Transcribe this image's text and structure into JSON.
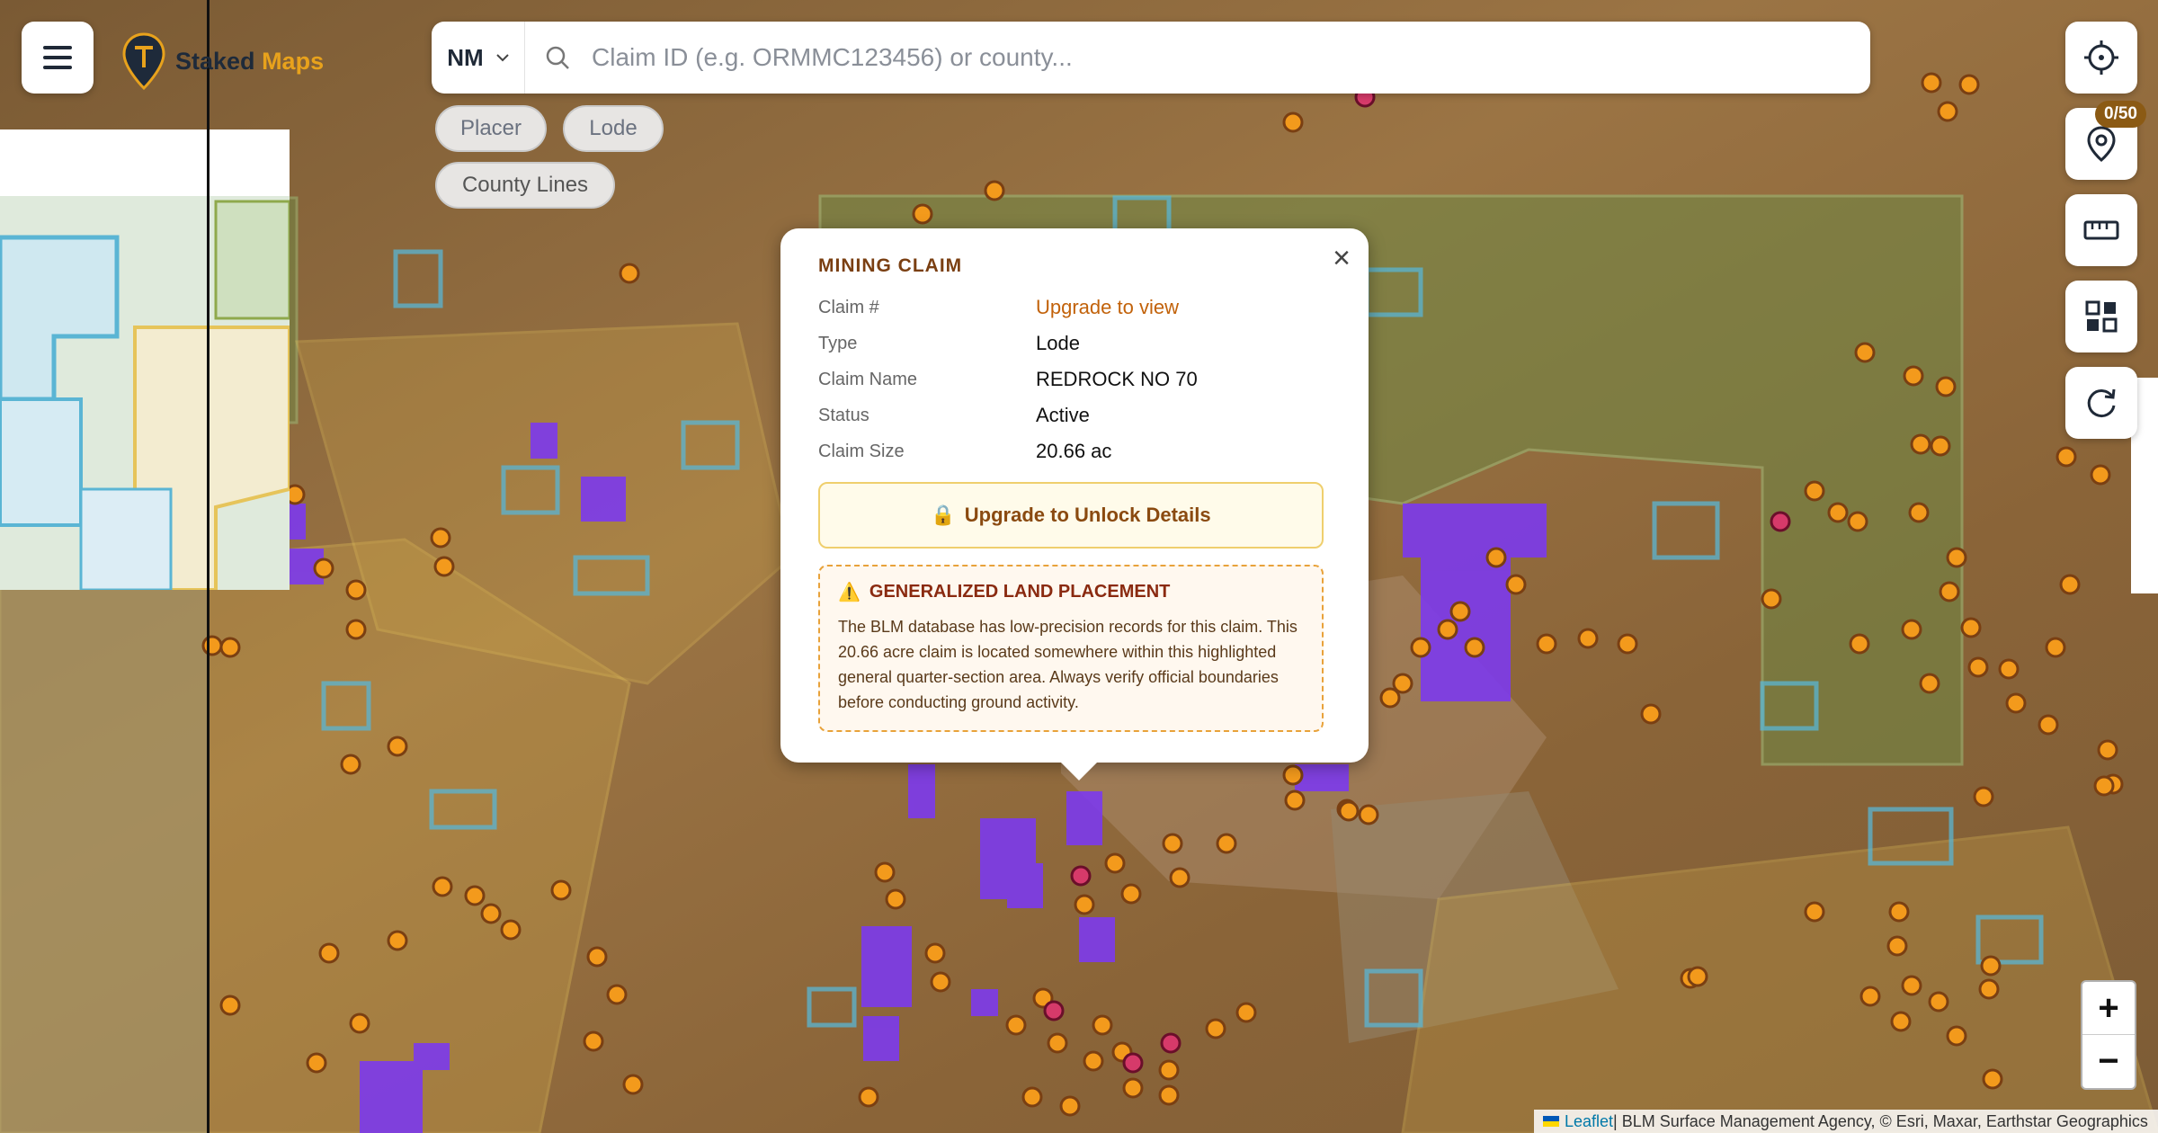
{
  "app": {
    "brand_primary": "Staked",
    "brand_secondary": "Maps",
    "brand_colors": {
      "primary": "#1e2a3a",
      "accent": "#e8a21c"
    }
  },
  "header": {
    "state_selected": "NM",
    "search_placeholder": "Claim ID (e.g. ORMMC123456) or county..."
  },
  "filters": {
    "placer": "Placer",
    "lode": "Lode",
    "county_lines": "County Lines"
  },
  "tools": {
    "claims_count_badge": "0/50",
    "icons": [
      "crosshair-icon",
      "location-pin-icon",
      "ruler-icon",
      "layers-grid-icon",
      "refresh-icon"
    ]
  },
  "popup": {
    "title": "MINING CLAIM",
    "fields": [
      {
        "label": "Claim #",
        "value": "Upgrade to view",
        "link": true
      },
      {
        "label": "Type",
        "value": "Lode"
      },
      {
        "label": "Claim Name",
        "value": "REDROCK NO 70"
      },
      {
        "label": "Status",
        "value": "Active"
      },
      {
        "label": "Claim Size",
        "value": "20.66 ac"
      }
    ],
    "upgrade_button": "Upgrade to Unlock Details",
    "warning_title": "GENERALIZED LAND PLACEMENT",
    "warning_body": "The BLM database has low-precision records for this claim. This 20.66 acre claim is located somewhere within this highlighted general quarter-section area. Always verify official boundaries before conducting ground activity."
  },
  "zoom": {
    "in": "+",
    "out": "−"
  },
  "attribution": {
    "leaflet": "Leaflet",
    "text": " | BLM Surface Management Agency, © Esri, Maxar, Earthstar Geographics"
  },
  "colors": {
    "claim_marker": "#f39a1c",
    "claim_polygon": "#7c3aed",
    "highlight_marker": "#d63a6a",
    "blm_land": "#8fa94c",
    "state_land": "#5ab5d4",
    "private_land": "#e6c45a"
  }
}
